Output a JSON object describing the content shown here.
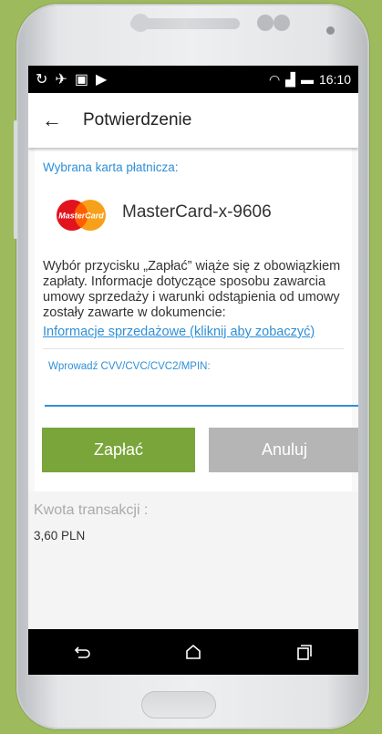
{
  "status_bar": {
    "time": "16:10"
  },
  "app_bar": {
    "title": "Potwierdzenie"
  },
  "payment_card": {
    "section_label": "Wybrana karta płatnicza:",
    "brand_logo_text": "MasterCard",
    "name": "MasterCard-x-9606"
  },
  "info": {
    "text": "Wybór przycisku „Zapłać” wiąże się z obowiązkiem zapłaty. Informacje dotyczące sposobu zawarcia umowy sprzedaży i warunki odstąpienia od umowy zostały zawarte w dokumencie:",
    "link_label": "Informacje sprzedażowe (kliknij aby zobaczyć)"
  },
  "cvv": {
    "label": "Wprowadź CVV/CVC/CVC2/MPIN:",
    "value": ""
  },
  "actions": {
    "pay_label": "Zapłać",
    "cancel_label": "Anuluj"
  },
  "transaction": {
    "amount_label": "Kwota transakcji :",
    "amount_value": "3,60 PLN"
  },
  "colors": {
    "accent_blue": "#2f8fd6",
    "pay_green": "#7aa53a",
    "cancel_gray": "#b5b5b5",
    "background_green": "#9dbb5c"
  }
}
